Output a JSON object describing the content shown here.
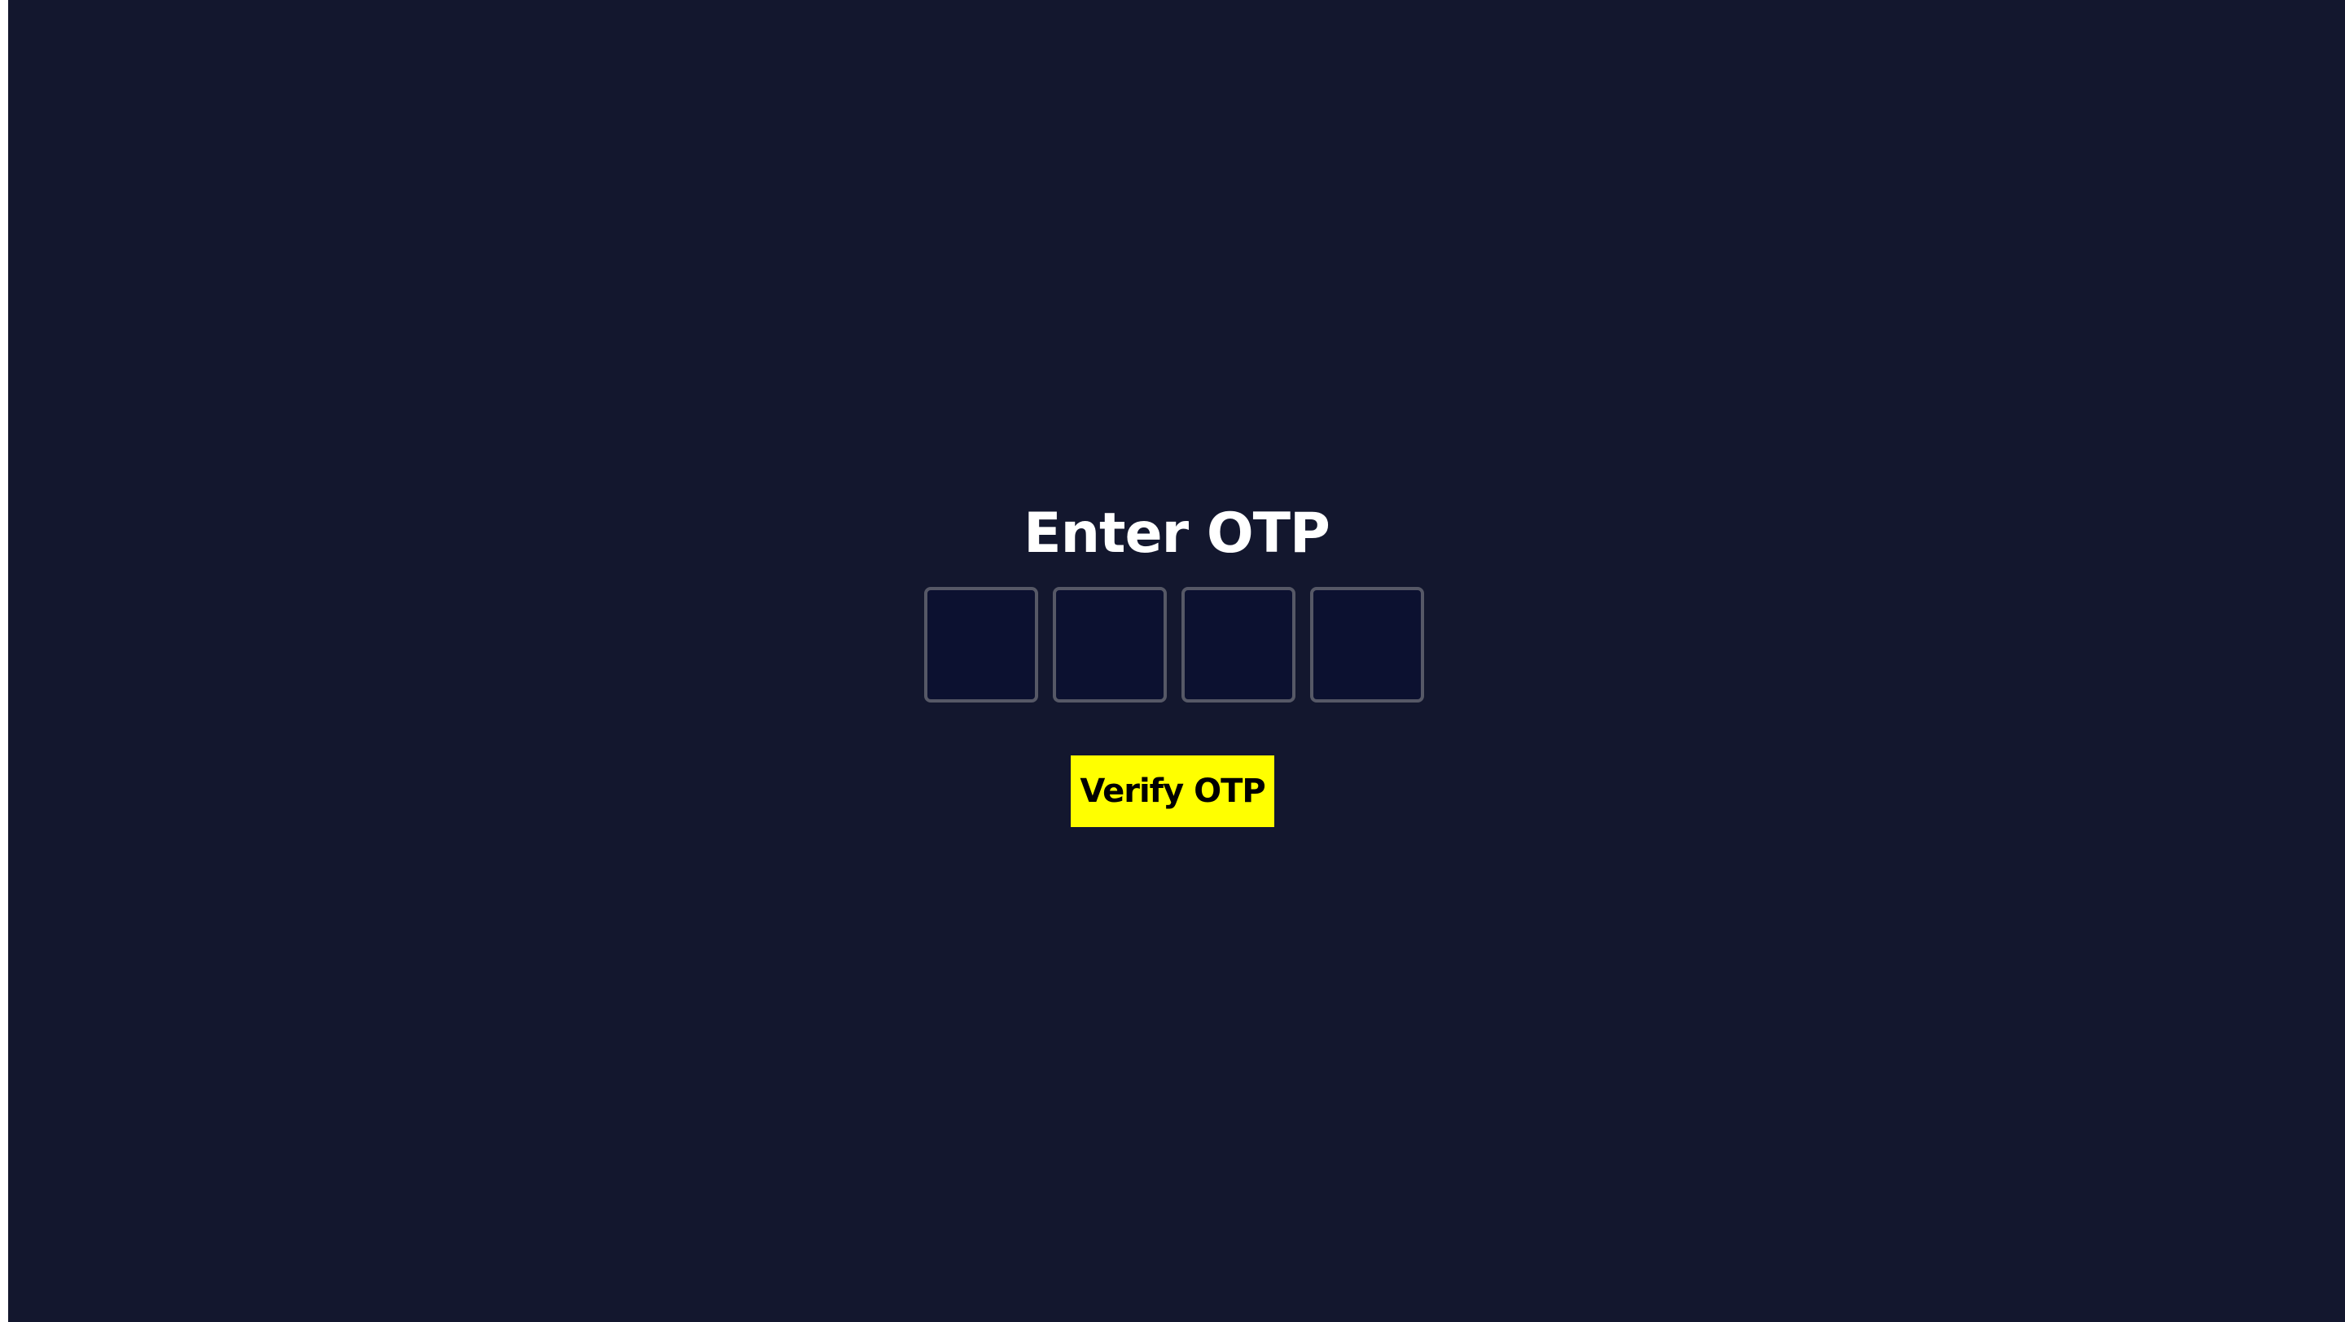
{
  "page": {
    "title": "Enter OTP"
  },
  "otp": {
    "digits": [
      "",
      "",
      "",
      ""
    ]
  },
  "actions": {
    "verify_label": "Verify OTP"
  },
  "colors": {
    "background": "#13172e",
    "input_fill": "#0c1130",
    "input_border": "#565866",
    "button_accent": "#ffff00",
    "title_text": "#ffffff"
  }
}
